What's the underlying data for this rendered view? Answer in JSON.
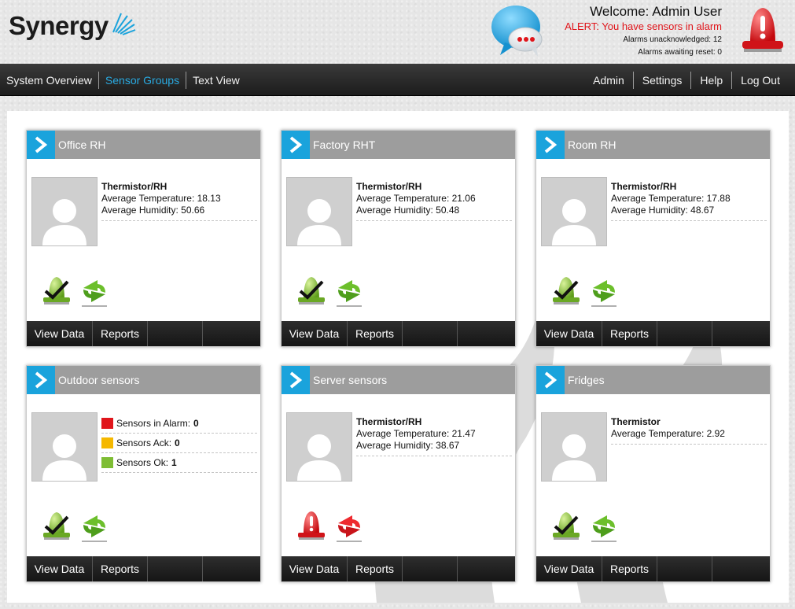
{
  "header": {
    "logo_text": "Synergy",
    "welcome": "Welcome: Admin User",
    "alert": "ALERT: You have sensors in alarm",
    "unacknowledged": "Alarms unacknowledged: 12",
    "awaiting_reset": "Alarms awaiting reset: 0",
    "icons": [
      "chat-bubble-icon",
      "alarm-siren-icon"
    ]
  },
  "nav": {
    "left": [
      "System Overview",
      "Sensor Groups",
      "Text View"
    ],
    "active": "Sensor Groups",
    "right": [
      "Admin",
      "Settings",
      "Help",
      "Log Out"
    ]
  },
  "colors": {
    "accent": "#1aa3dc",
    "alarm_red": "#e0151b",
    "ack_yellow": "#f5b800",
    "ok_green": "#7ebd34"
  },
  "cards": [
    {
      "title": "Office RH",
      "type": "Thermistor/RH",
      "lines": [
        "Average Temperature: 18.13",
        "Average Humidity: 50.66"
      ],
      "state": "ok",
      "footer": [
        "View Data",
        "Reports"
      ]
    },
    {
      "title": "Factory RHT",
      "type": "Thermistor/RH",
      "lines": [
        "Average Temperature: 21.06",
        "Average Humidity: 50.48"
      ],
      "state": "ok",
      "footer": [
        "View Data",
        "Reports"
      ]
    },
    {
      "title": "Room RH",
      "type": "Thermistor/RH",
      "lines": [
        "Average Temperature: 17.88",
        "Average Humidity: 48.67"
      ],
      "state": "ok",
      "footer": [
        "View Data",
        "Reports"
      ]
    },
    {
      "title": "Outdoor sensors",
      "status": [
        {
          "label": "Sensors in Alarm:",
          "count": "0",
          "color": "#e0151b"
        },
        {
          "label": "Sensors Ack:",
          "count": "0",
          "color": "#f5b800"
        },
        {
          "label": "Sensors Ok:",
          "count": "1",
          "color": "#7ebd34"
        }
      ],
      "state": "ok",
      "footer": [
        "View Data",
        "Reports"
      ]
    },
    {
      "title": "Server sensors",
      "type": "Thermistor/RH",
      "lines": [
        "Average Temperature: 21.47",
        "Average Humidity: 38.67"
      ],
      "state": "alarm",
      "footer": [
        "View Data",
        "Reports"
      ]
    },
    {
      "title": "Fridges",
      "type": "Thermistor",
      "lines": [
        "Average Temperature: 2.92"
      ],
      "state": "ok",
      "footer": [
        "View Data",
        "Reports"
      ]
    }
  ]
}
